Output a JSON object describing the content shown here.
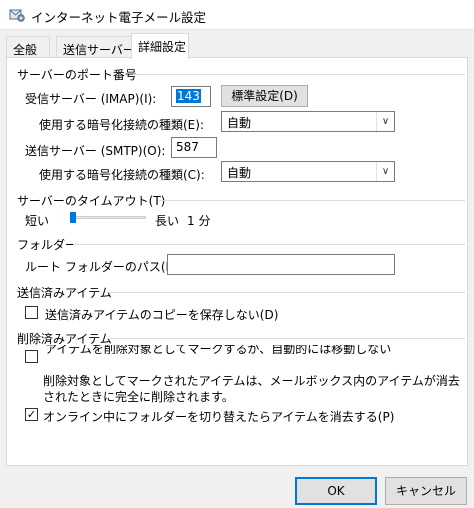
{
  "window": {
    "title": "インターネット電子メール設定",
    "icon": "mail-settings-icon"
  },
  "tabs": [
    {
      "label": "全般"
    },
    {
      "label": "送信サーバー"
    },
    {
      "label": "詳細設定",
      "active": true
    }
  ],
  "server_ports": {
    "heading": "サーバーのポート番号",
    "incoming_label": "受信サーバー (IMAP)(I):",
    "incoming_value": "143",
    "default_button": "標準設定(D)",
    "incoming_encryption_label": "使用する暗号化接続の種類(E):",
    "incoming_encryption_value": "自動",
    "outgoing_label": "送信サーバー (SMTP)(O):",
    "outgoing_value": "587",
    "outgoing_encryption_label": "使用する暗号化接続の種類(C):",
    "outgoing_encryption_value": "自動"
  },
  "timeout": {
    "heading": "サーバーのタイムアウト(T)",
    "short_label": "短い",
    "long_label": "長い",
    "value_text": "1 分",
    "level": 0.0
  },
  "folders": {
    "heading": "フォルダー",
    "root_path_label": "ルート フォルダーのパス(F):",
    "root_path_value": ""
  },
  "sent_items": {
    "heading": "送信済みアイテム",
    "no_copy_label": "送信済みアイテムのコピーを保存しない(D)",
    "no_copy_checked": false
  },
  "deleted_items": {
    "heading": "削除済みアイテム",
    "mark_label": "アイテムを削除対象としてマークするが、自動的には移動しない",
    "mark_checked": false,
    "note_line1": "削除対象としてマークされたアイテムは、メールボックス内のアイテムが消去",
    "note_line2": "されたときに完全に削除されます。",
    "purge_label": "オンライン中にフォルダーを切り替えたらアイテムを消去する(P)",
    "purge_checked": true
  },
  "footer": {
    "ok_label": "OK",
    "cancel_label": "キャンセル"
  }
}
